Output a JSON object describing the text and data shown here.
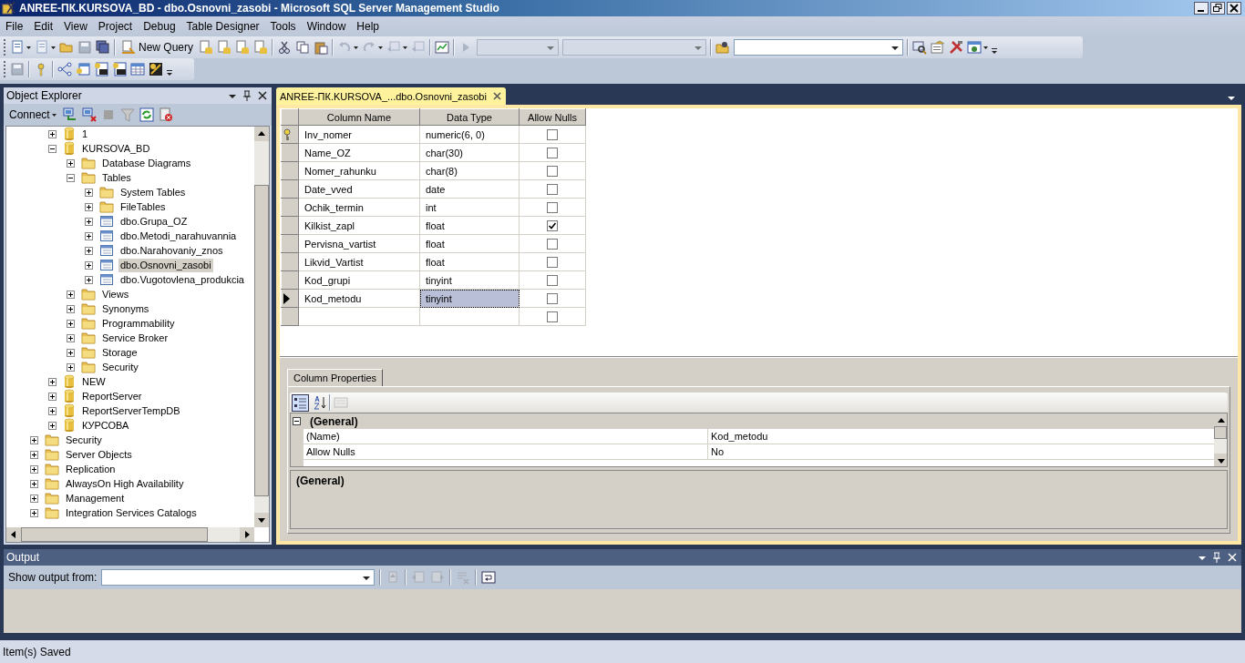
{
  "window": {
    "title": "ANREE-ПК.KURSOVA_BD - dbo.Osnovni_zasobi - Microsoft SQL Server Management Studio"
  },
  "menu": [
    "File",
    "Edit",
    "View",
    "Project",
    "Debug",
    "Table Designer",
    "Tools",
    "Window",
    "Help"
  ],
  "toolbar": {
    "new_query": "New Query",
    "combos": [
      {
        "disabled": true
      },
      {
        "disabled": true
      },
      {
        "disabled": false
      }
    ]
  },
  "object_explorer": {
    "title": "Object Explorer",
    "connect": "Connect",
    "scrolled_branch": [
      {
        "label": "1",
        "kind": "database",
        "expanded": false,
        "selected": false
      },
      {
        "label": "KURSOVA_BD",
        "kind": "database",
        "expanded": true,
        "selected": false,
        "children": [
          {
            "label": "Database Diagrams",
            "kind": "folder",
            "expanded": false,
            "selected": false
          },
          {
            "label": "Tables",
            "kind": "folder",
            "expanded": true,
            "selected": false,
            "children": [
              {
                "label": "System Tables",
                "kind": "folder",
                "expanded": false,
                "selected": false
              },
              {
                "label": "FileTables",
                "kind": "folder",
                "expanded": false,
                "selected": false
              },
              {
                "label": "dbo.Grupa_OZ",
                "kind": "table",
                "expanded": false,
                "selected": false
              },
              {
                "label": "dbo.Metodi_narahuvannia",
                "kind": "table",
                "expanded": false,
                "selected": false
              },
              {
                "label": "dbo.Narahovaniy_znos",
                "kind": "table",
                "expanded": false,
                "selected": false
              },
              {
                "label": "dbo.Osnovni_zasobi",
                "kind": "table",
                "expanded": false,
                "selected": true
              },
              {
                "label": "dbo.Vugotovlena_produkcia",
                "kind": "table",
                "expanded": false,
                "selected": false
              }
            ]
          },
          {
            "label": "Views",
            "kind": "folder",
            "expanded": false,
            "selected": false
          },
          {
            "label": "Synonyms",
            "kind": "folder",
            "expanded": false,
            "selected": false
          },
          {
            "label": "Programmability",
            "kind": "folder",
            "expanded": false,
            "selected": false
          },
          {
            "label": "Service Broker",
            "kind": "folder",
            "expanded": false,
            "selected": false
          },
          {
            "label": "Storage",
            "kind": "folder",
            "expanded": false,
            "selected": false
          },
          {
            "label": "Security",
            "kind": "folder",
            "expanded": false,
            "selected": false
          }
        ]
      },
      {
        "label": "NEW",
        "kind": "database",
        "expanded": false,
        "selected": false
      },
      {
        "label": "ReportServer",
        "kind": "database",
        "expanded": false,
        "selected": false
      },
      {
        "label": "ReportServerTempDB",
        "kind": "database",
        "expanded": false,
        "selected": false
      },
      {
        "label": "КУРСОВА",
        "kind": "database",
        "expanded": false,
        "selected": false
      }
    ],
    "server_items": [
      {
        "label": "Security",
        "kind": "folder",
        "expanded": false,
        "selected": false
      },
      {
        "label": "Server Objects",
        "kind": "folder",
        "expanded": false,
        "selected": false
      },
      {
        "label": "Replication",
        "kind": "folder",
        "expanded": false,
        "selected": false
      },
      {
        "label": "AlwaysOn High Availability",
        "kind": "folder",
        "expanded": false,
        "selected": false
      },
      {
        "label": "Management",
        "kind": "folder",
        "expanded": false,
        "selected": false
      },
      {
        "label": "Integration Services Catalogs",
        "kind": "folder",
        "expanded": false,
        "selected": false
      }
    ]
  },
  "document_tab": {
    "label": "ANREE-ПК.KURSOVA_...dbo.Osnovni_zasobi",
    "selected": true
  },
  "designer": {
    "columns": [
      "Column Name",
      "Data Type",
      "Allow Nulls"
    ],
    "rows": [
      {
        "name": "Inv_nomer",
        "type": "numeric(6, 0)",
        "allow_nulls": false,
        "primary_key": true,
        "selected": false
      },
      {
        "name": "Name_OZ",
        "type": "char(30)",
        "allow_nulls": false,
        "primary_key": false,
        "selected": false
      },
      {
        "name": "Nomer_rahunku",
        "type": "char(8)",
        "allow_nulls": false,
        "primary_key": false,
        "selected": false
      },
      {
        "name": "Date_vved",
        "type": "date",
        "allow_nulls": false,
        "primary_key": false,
        "selected": false
      },
      {
        "name": "Ochik_termin",
        "type": "int",
        "allow_nulls": false,
        "primary_key": false,
        "selected": false
      },
      {
        "name": "Kilkist_zapl",
        "type": "float",
        "allow_nulls": true,
        "primary_key": false,
        "selected": false
      },
      {
        "name": "Pervisna_vartist",
        "type": "float",
        "allow_nulls": false,
        "primary_key": false,
        "selected": false
      },
      {
        "name": "Likvid_Vartist",
        "type": "float",
        "allow_nulls": false,
        "primary_key": false,
        "selected": false
      },
      {
        "name": "Kod_grupi",
        "type": "tinyint",
        "allow_nulls": false,
        "primary_key": false,
        "selected": false
      },
      {
        "name": "Kod_metodu",
        "type": "tinyint",
        "allow_nulls": false,
        "primary_key": false,
        "selected": true
      }
    ],
    "new_row": {
      "allow_nulls": false
    }
  },
  "column_properties": {
    "tab": "Column Properties",
    "category": {
      "label": "(General)",
      "expanded": true
    },
    "properties": [
      {
        "name": "(Name)",
        "value": "Kod_metodu"
      },
      {
        "name": "Allow Nulls",
        "value": "No"
      }
    ],
    "description": "(General)"
  },
  "output": {
    "title": "Output",
    "show_from_label": "Show output from:"
  },
  "status_bar": "Item(s) Saved"
}
